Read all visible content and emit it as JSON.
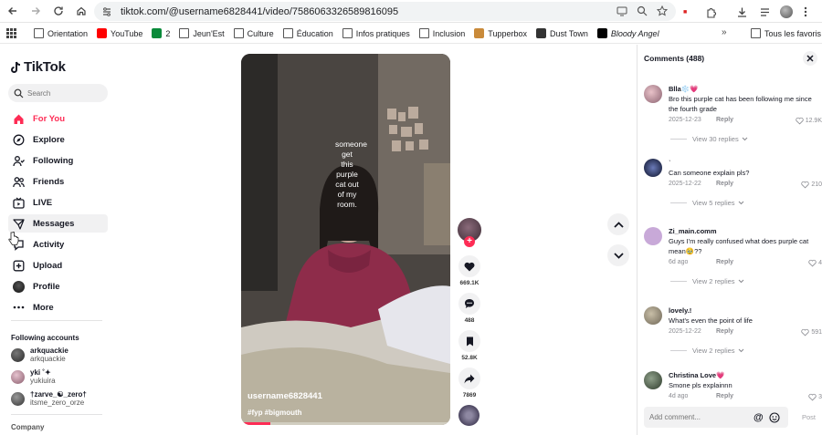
{
  "browser": {
    "url": "tiktok.com/@username6828441/video/7586063326589816095",
    "bookmarks": [
      {
        "label": "Orientation",
        "icon": "folder-icon"
      },
      {
        "label": "YouTube",
        "icon": "youtube-icon"
      },
      {
        "label": "2",
        "icon": "bookmark-favicon-icon"
      },
      {
        "label": "Jeun'Est",
        "icon": "folder-icon"
      },
      {
        "label": "Culture",
        "icon": "folder-icon"
      },
      {
        "label": "Éducation",
        "icon": "folder-icon"
      },
      {
        "label": "Infos pratiques",
        "icon": "folder-icon"
      },
      {
        "label": "Inclusion",
        "icon": "folder-icon"
      },
      {
        "label": "Tupperbox",
        "icon": "tupperbox-icon"
      },
      {
        "label": "Dust Town",
        "icon": "dust-town-icon"
      },
      {
        "label": "Bloody Angel",
        "icon": "tiktok-favicon-icon"
      }
    ],
    "all_bookmarks": "Tous les favoris"
  },
  "sidebar": {
    "logo": "TikTok",
    "search_placeholder": "Search",
    "nav": [
      {
        "label": "For You",
        "icon": "home-icon"
      },
      {
        "label": "Explore",
        "icon": "compass-icon"
      },
      {
        "label": "Following",
        "icon": "following-icon"
      },
      {
        "label": "Friends",
        "icon": "friends-icon"
      },
      {
        "label": "LIVE",
        "icon": "live-icon"
      },
      {
        "label": "Messages",
        "icon": "messages-icon"
      },
      {
        "label": "Activity",
        "icon": "activity-icon"
      },
      {
        "label": "Upload",
        "icon": "upload-icon"
      },
      {
        "label": "Profile",
        "icon": "profile-icon"
      },
      {
        "label": "More",
        "icon": "more-icon"
      }
    ],
    "following_title": "Following accounts",
    "accounts": [
      {
        "name": "arkquackie",
        "handle": "arkquackie"
      },
      {
        "name": "yki ˚✦",
        "handle": "yukiuira"
      },
      {
        "name": "†zarve_☯_zero†",
        "handle": "itsme_zero_orze"
      }
    ],
    "company": "Company"
  },
  "video": {
    "overlay_text": "someone get this purple cat out of my room.",
    "author": "username6828441",
    "tags": "#fyp #bigmouth",
    "likes": "669.1K",
    "comments": "488",
    "saves": "52.8K",
    "shares": "7869"
  },
  "comments_panel": {
    "title": "Comments (488)",
    "items": [
      {
        "user": "Blla❄️💗",
        "text": "Bro this purple cat has been following me since the fourth grade",
        "date": "2025-12-23",
        "reply": "Reply",
        "likes": "12.9K",
        "view_replies": "View 30 replies"
      },
      {
        "user": "ʾ",
        "text": "Can someone explain pls?",
        "date": "2025-12-22",
        "reply": "Reply",
        "likes": "210",
        "view_replies": "View 5 replies"
      },
      {
        "user": "Zi_main.comm",
        "text": "Guys I'm really confused what does purple cat mean🥹??",
        "date": "6d ago",
        "reply": "Reply",
        "likes": "4",
        "view_replies": "View 2 replies"
      },
      {
        "user": "lovely.!",
        "text": "What's even the point of life",
        "date": "2025-12-22",
        "reply": "Reply",
        "likes": "591",
        "view_replies": "View 2 replies"
      },
      {
        "user": "Christina Love💗",
        "text": "Smone pls explainnn",
        "date": "4d ago",
        "reply": "Reply",
        "likes": "3",
        "view_replies": ""
      }
    ],
    "input_placeholder": "Add comment...",
    "post": "Post"
  },
  "colors": {
    "accent": "#fe2c55"
  }
}
